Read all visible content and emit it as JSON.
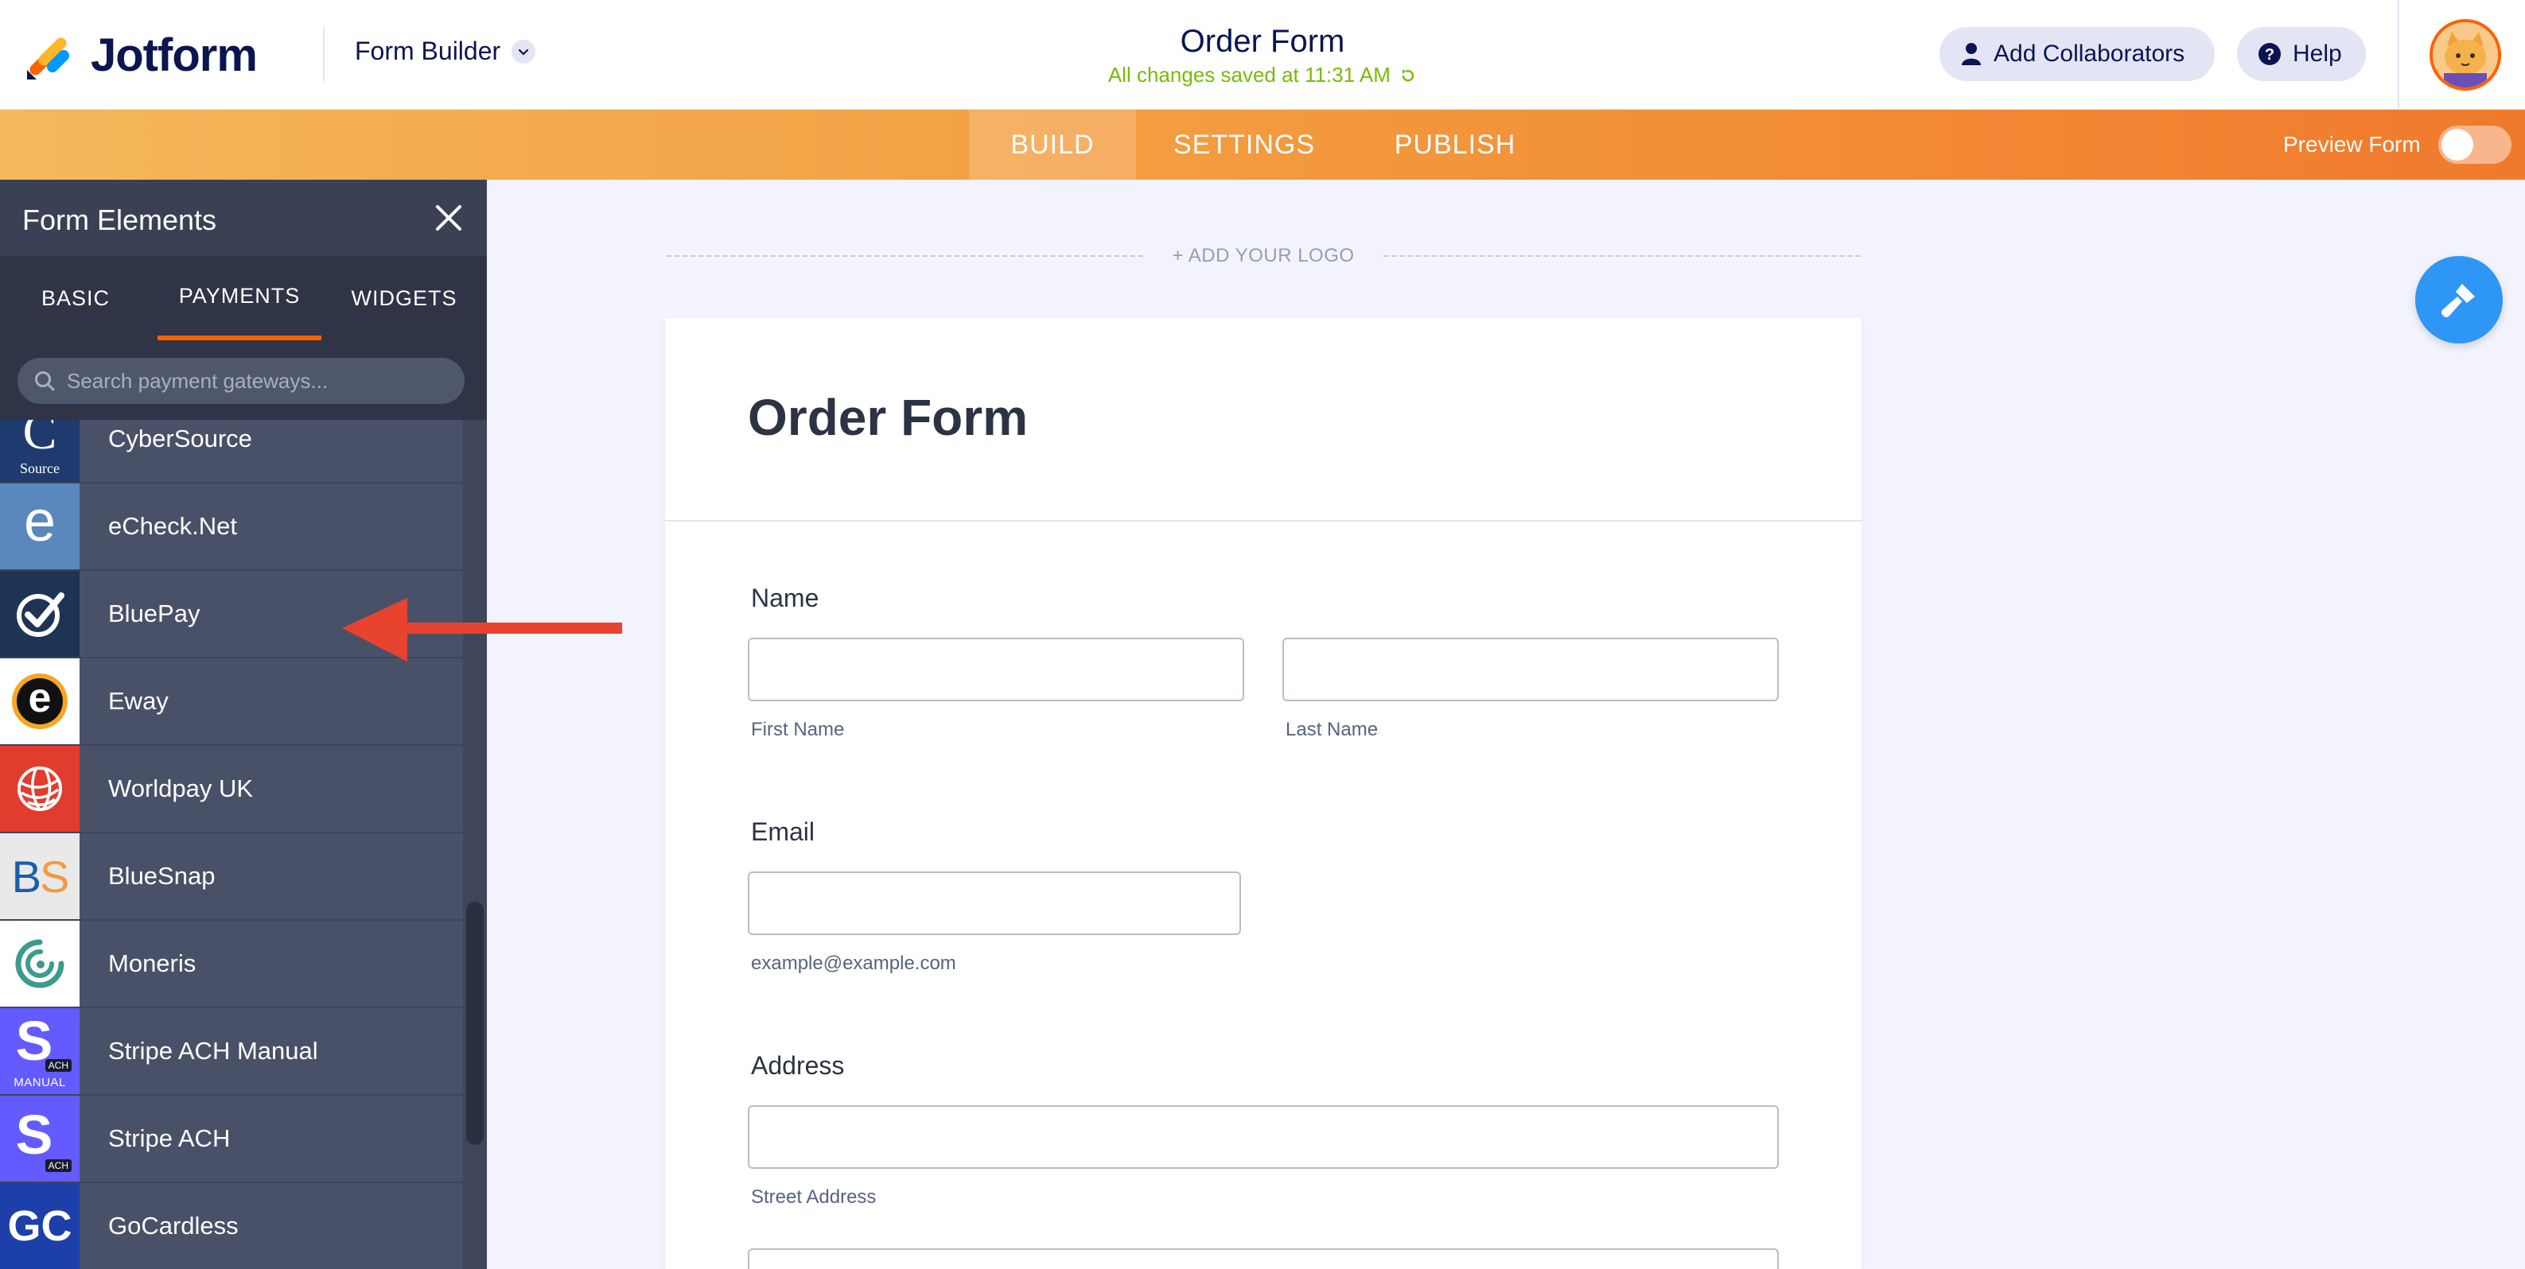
{
  "app": {
    "brand": "Jotform",
    "builder_label": "Form Builder",
    "form_title": "Order Form",
    "save_status": "All changes saved at 11:31 AM",
    "add_collaborators": "Add Collaborators",
    "help": "Help"
  },
  "nav": {
    "tabs": [
      {
        "label": "BUILD",
        "active": true
      },
      {
        "label": "SETTINGS",
        "active": false
      },
      {
        "label": "PUBLISH",
        "active": false
      }
    ],
    "preview_label": "Preview Form",
    "preview_on": false
  },
  "panel": {
    "title": "Form Elements",
    "tabs": [
      {
        "label": "BASIC",
        "active": false
      },
      {
        "label": "PAYMENTS",
        "active": true
      },
      {
        "label": "WIDGETS",
        "active": false
      }
    ],
    "search_placeholder": "Search payment gateways...",
    "gateways": [
      {
        "label": "CyberSource",
        "icon": "cybersource-logo",
        "logo_text": "C",
        "logo_sub": "Source",
        "bg": "#1f3a6e"
      },
      {
        "label": "eCheck.Net",
        "icon": "echeck-logo",
        "logo_text": "e",
        "bg": "#5a88bd"
      },
      {
        "label": "BluePay",
        "icon": "bluepay-logo",
        "bg": "#1f3354"
      },
      {
        "label": "Eway",
        "icon": "eway-logo",
        "logo_text": "e",
        "bg": "#ffffff"
      },
      {
        "label": "Worldpay UK",
        "icon": "worldpay-logo",
        "bg": "#e23c2e"
      },
      {
        "label": "BlueSnap",
        "icon": "bluesnap-logo",
        "logo_text": "BS",
        "bg": "#e9e9ea"
      },
      {
        "label": "Moneris",
        "icon": "moneris-logo",
        "bg": "#ffffff"
      },
      {
        "label": "Stripe ACH Manual",
        "icon": "stripe-ach-manual-logo",
        "logo_text": "S",
        "badge": "ACH",
        "logo_sub": "MANUAL",
        "bg": "#635bff"
      },
      {
        "label": "Stripe ACH",
        "icon": "stripe-ach-logo",
        "logo_text": "S",
        "badge": "ACH",
        "bg": "#635bff"
      },
      {
        "label": "GoCardless",
        "icon": "gocardless-logo",
        "logo_text": "GC",
        "bg": "#1c3faa"
      }
    ]
  },
  "canvas": {
    "add_logo": "+ ADD YOUR LOGO",
    "form_heading": "Order Form",
    "fields": {
      "name_label": "Name",
      "first_name_sub": "First Name",
      "last_name_sub": "Last Name",
      "email_label": "Email",
      "email_sub": "example@example.com",
      "address_label": "Address",
      "street_sub": "Street Address"
    }
  },
  "colors": {
    "accent_orange": "#ff6100",
    "save_green": "#78bb07",
    "brush_blue": "#2e96f4",
    "arrow_red": "#e8432e"
  }
}
